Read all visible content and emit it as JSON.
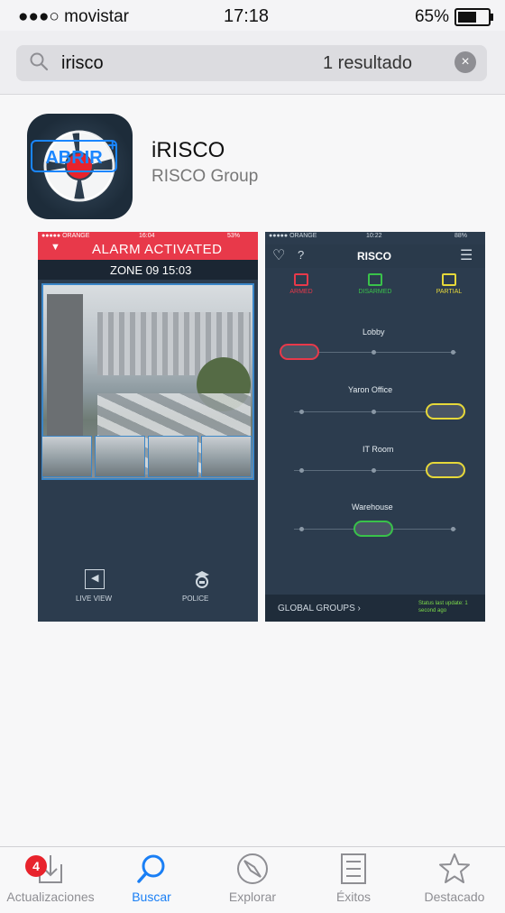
{
  "status_bar": {
    "carrier": "●●●○ movistar",
    "time": "17:18",
    "battery": "65%"
  },
  "search": {
    "query": "irisco",
    "result_count": "1 resultado"
  },
  "app": {
    "name": "iRISCO",
    "developer": "RISCO Group",
    "open_label": "ABRIR",
    "open_plus": "+"
  },
  "screenshot_left": {
    "carrier": "●●●●● ORANGE",
    "time": "16:04",
    "battery": "53%",
    "alarm_text": "ALARM ACTIVATED",
    "zone_text": "ZONE 09   15:03",
    "police_label": "POLICE",
    "live_view_label": "LIVE VIEW"
  },
  "screenshot_right": {
    "carrier": "●●●●● ORANGE",
    "time": "10:22",
    "battery": "88%",
    "logo": "RISCO",
    "modes": [
      "PARTIAL",
      "DISARMED",
      "ARMED"
    ],
    "areas": [
      "Lobby",
      "Yaron Office",
      "IT Room",
      "Warehouse"
    ],
    "footer_label": "GLOBAL GROUPS  ›",
    "footer_status": "Status last update: 1 second ago"
  },
  "tab_bar": {
    "items": [
      "Destacado",
      "Éxitos",
      "Explorar",
      "Buscar",
      "Actualizaciones"
    ],
    "badge": "4"
  },
  "colors": {
    "accent": "#1a7ff5",
    "alarm": "#e8394a",
    "armed": "#e8394a",
    "disarmed": "#39c24a",
    "partial": "#e6d83a"
  }
}
